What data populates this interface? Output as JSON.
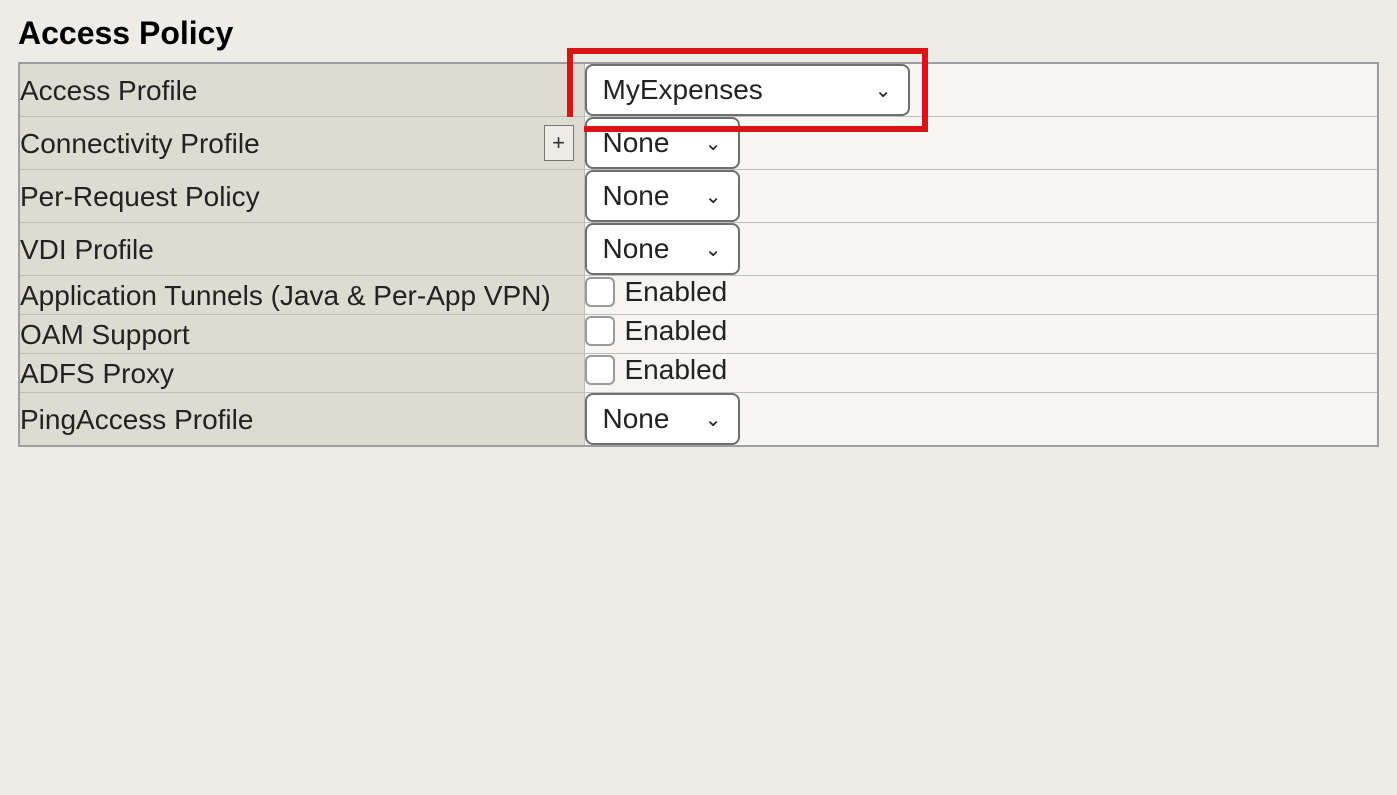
{
  "section_title": "Access Policy",
  "rows": {
    "access_profile": {
      "label": "Access Profile",
      "value": "MyExpenses"
    },
    "connectivity_profile": {
      "label": "Connectivity Profile",
      "value": "None",
      "plus": "+"
    },
    "per_request_policy": {
      "label": "Per-Request Policy",
      "value": "None"
    },
    "vdi_profile": {
      "label": "VDI Profile",
      "value": "None"
    },
    "app_tunnels": {
      "label": "Application Tunnels (Java & Per-App VPN)",
      "cb_label": "Enabled"
    },
    "oam_support": {
      "label": "OAM Support",
      "cb_label": "Enabled"
    },
    "adfs_proxy": {
      "label": "ADFS Proxy",
      "cb_label": "Enabled"
    },
    "pingaccess_profile": {
      "label": "PingAccess Profile",
      "value": "None"
    }
  }
}
